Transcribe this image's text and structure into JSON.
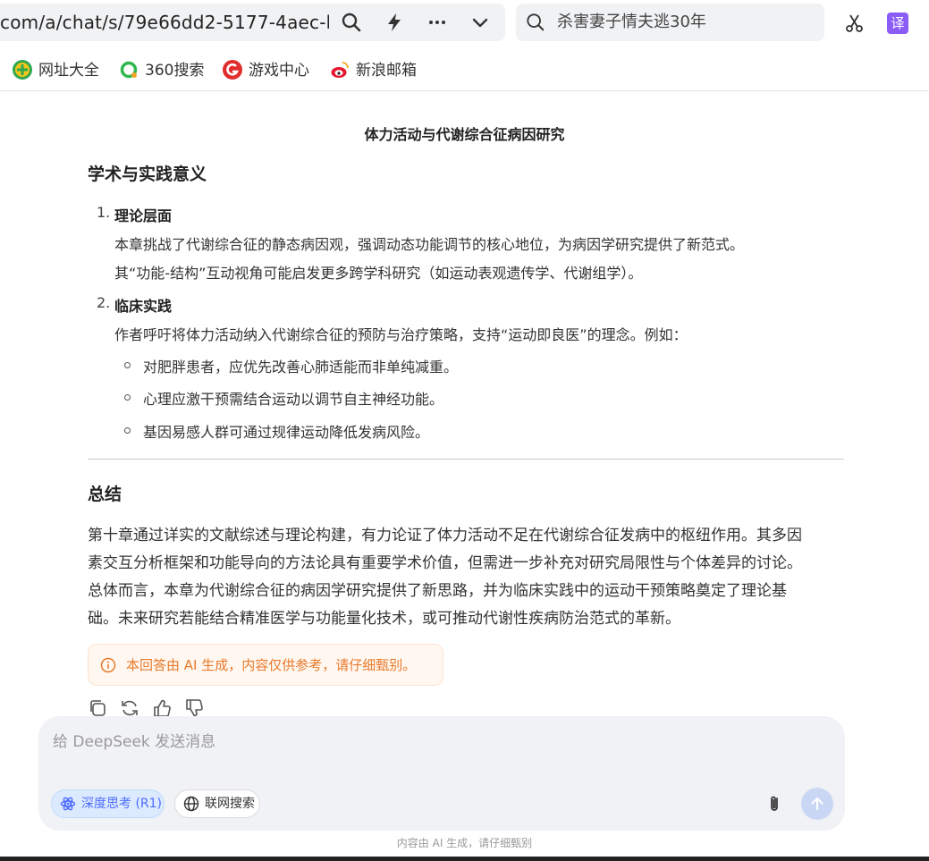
{
  "browser": {
    "url": "com/a/chat/s/79e66dd2-5177-4aec-b",
    "search_query": "杀害妻子情夫逃30年",
    "translate_label": "译"
  },
  "bookmarks": [
    {
      "label": "网址大全",
      "icon": "plus-circle-icon"
    },
    {
      "label": "360搜索",
      "icon": "360-search-icon"
    },
    {
      "label": "游戏中心",
      "icon": "game-center-icon"
    },
    {
      "label": "新浪邮箱",
      "icon": "sina-mail-icon"
    }
  ],
  "content": {
    "doc_title": "体力活动与代谢综合征病因研究",
    "section_heading": "学术与实践意义",
    "items": [
      {
        "num": "1.",
        "title": "理论层面",
        "lines": [
          "本章挑战了代谢综合征的静态病因观，强调动态功能调节的核心地位，为病因学研究提供了新范式。",
          "其“功能-结构”互动视角可能启发更多跨学科研究（如运动表观遗传学、代谢组学）。"
        ]
      },
      {
        "num": "2.",
        "title": "临床实践",
        "lines": [
          "作者呼吁将体力活动纳入代谢综合征的预防与治疗策略，支持“运动即良医”的理念。例如："
        ],
        "bullets": [
          "对肥胖患者，应优先改善心肺适能而非单纯减重。",
          "心理应激干预需结合运动以调节自主神经功能。",
          "基因易感人群可通过规律运动降低发病风险。"
        ]
      }
    ],
    "summary_heading": "总结",
    "summary_lines": [
      "第十章通过详实的文献综述与理论构建，有力论证了体力活动不足在代谢综合征发病中的枢纽作用。其多因",
      "素交互分析框架和功能导向的方法论具有重要学术价值，但需进一步补充对研究局限性与个体差异的讨论。",
      "总体而言，本章为代谢综合征的病因学研究提供了新思路，并为临床实践中的运动干预策略奠定了理论基",
      "础。未来研究若能结合精准医学与功能量化技术，或可推动代谢性疾病防治范式的革新。"
    ],
    "ai_notice": "本回答由 AI 生成，内容仅供参考，请仔细甄别。"
  },
  "composer": {
    "placeholder": "给 DeepSeek 发送消息",
    "deep_think_label": "深度思考 (R1)",
    "web_search_label": "联网搜索",
    "footer_note": "内容由 AI 生成，请仔细甄别"
  },
  "colors": {
    "accent": "#4d6bfe",
    "notice_text": "#e87a2c",
    "notice_bg": "#fff7f0"
  }
}
